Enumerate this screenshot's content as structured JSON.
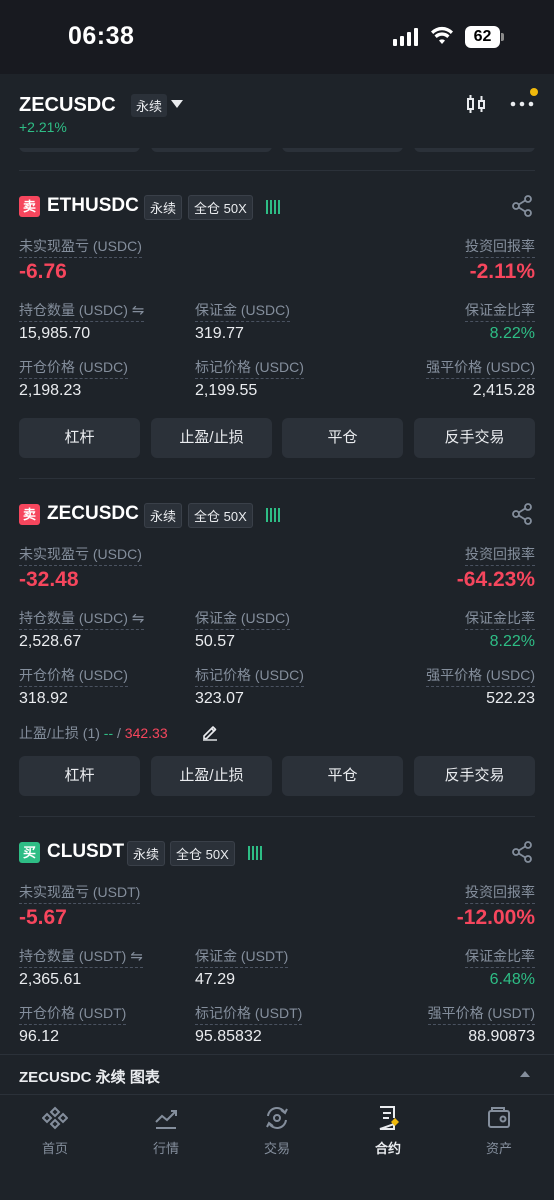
{
  "status": {
    "time": "06:38",
    "battery": "62"
  },
  "header": {
    "symbol": "ZECUSDC",
    "perp_tag": "永续",
    "change": "+2.21%"
  },
  "positions": [
    {
      "side": "卖",
      "side_type": "sell",
      "symbol": "ETHUSDC",
      "perp_tag": "永续",
      "margin_tag": "全仓 50X",
      "pnl_label": "未实现盈亏 (USDC)",
      "pnl": "-6.76",
      "roe_label": "投资回报率",
      "roe": "-2.11%",
      "size_label": "持仓数量 (USDC)",
      "size": "15,985.70",
      "margin_label": "保证金 (USDC)",
      "margin": "319.77",
      "ratio_label": "保证金比率",
      "ratio": "8.22%",
      "entry_label": "开仓价格 (USDC)",
      "entry": "2,198.23",
      "mark_label": "标记价格 (USDC)",
      "mark": "2,199.55",
      "liq_label": "强平价格 (USDC)",
      "liq": "2,415.28"
    },
    {
      "side": "卖",
      "side_type": "sell",
      "symbol": "ZECUSDC",
      "perp_tag": "永续",
      "margin_tag": "全仓 50X",
      "pnl_label": "未实现盈亏 (USDC)",
      "pnl": "-32.48",
      "roe_label": "投资回报率",
      "roe": "-64.23%",
      "size_label": "持仓数量 (USDC)",
      "size": "2,528.67",
      "margin_label": "保证金 (USDC)",
      "margin": "50.57",
      "ratio_label": "保证金比率",
      "ratio": "8.22%",
      "entry_label": "开仓价格 (USDC)",
      "entry": "318.92",
      "mark_label": "标记价格 (USDC)",
      "mark": "323.07",
      "liq_label": "强平价格 (USDC)",
      "liq": "522.23",
      "tpsl_label": "止盈/止损 (1)",
      "tpsl_tp": "--",
      "tpsl_sep": "/",
      "tpsl_sl": "342.33"
    },
    {
      "side": "买",
      "side_type": "buy",
      "symbol": "CLUSDT",
      "perp_tag": "永续",
      "margin_tag": "全仓 50X",
      "pnl_label": "未实现盈亏 (USDT)",
      "pnl": "-5.67",
      "roe_label": "投资回报率",
      "roe": "-12.00%",
      "size_label": "持仓数量 (USDT)",
      "size": "2,365.61",
      "margin_label": "保证金 (USDT)",
      "margin": "47.29",
      "ratio_label": "保证金比率",
      "ratio": "6.48%",
      "entry_label": "开仓价格 (USDT)",
      "entry": "96.12",
      "mark_label": "标记价格 (USDT)",
      "mark": "95.85832",
      "liq_label": "强平价格 (USDT)",
      "liq": "88.90873"
    }
  ],
  "actions": {
    "leverage": "杠杆",
    "tpsl": "止盈/止损",
    "close": "平仓",
    "reverse": "反手交易"
  },
  "chart_bar": {
    "title": "ZECUSDC 永续 图表"
  },
  "tabs": [
    {
      "label": "首页",
      "icon": "binance-logo-icon"
    },
    {
      "label": "行情",
      "icon": "markets-chart-icon"
    },
    {
      "label": "交易",
      "icon": "trade-swap-icon"
    },
    {
      "label": "合约",
      "icon": "futures-doc-icon"
    },
    {
      "label": "资产",
      "icon": "wallet-icon"
    }
  ],
  "colors": {
    "background": "#1e2329",
    "up": "#2ebd85",
    "down": "#f6465d",
    "accent": "#f0b90b",
    "muted": "#848e9c"
  }
}
